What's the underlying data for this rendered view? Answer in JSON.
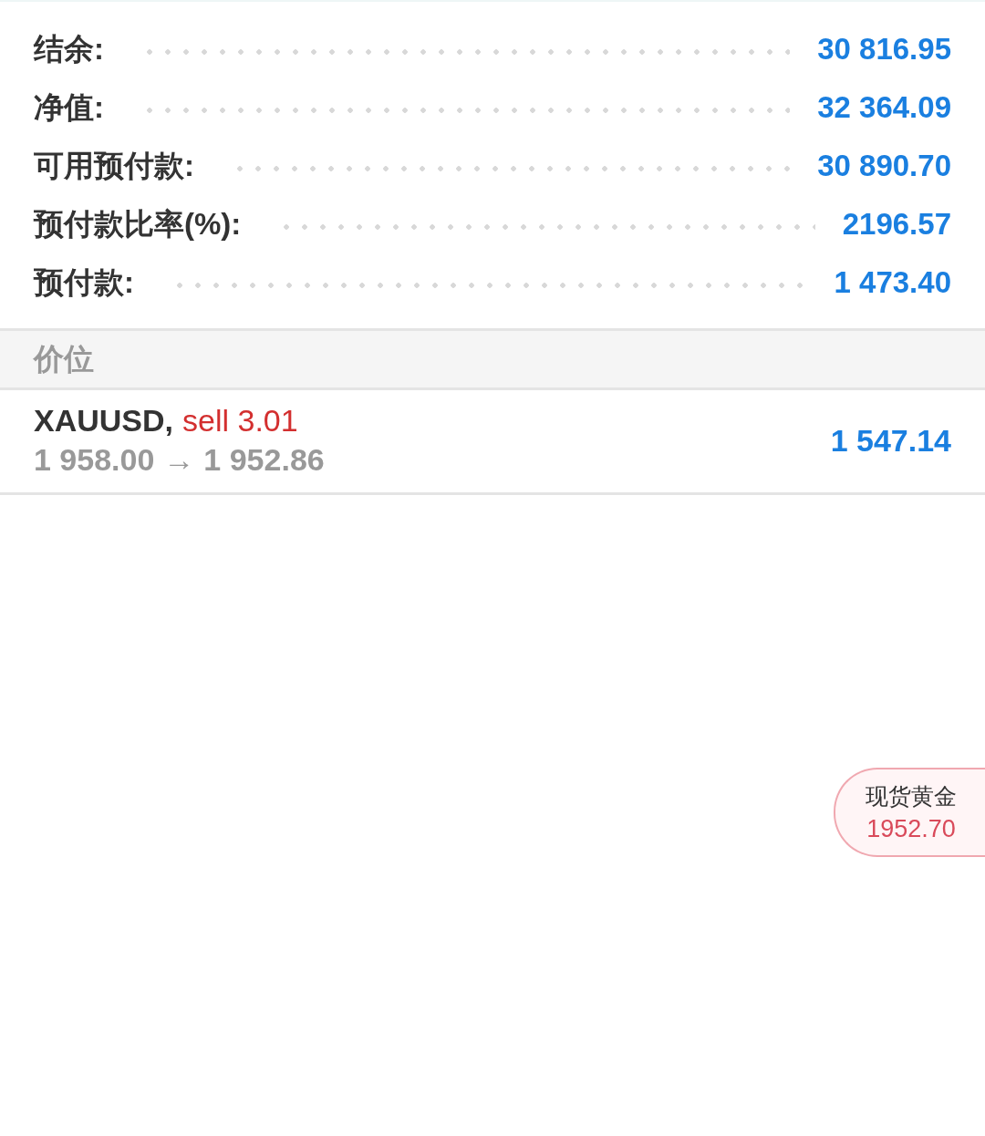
{
  "summary": [
    {
      "label": "结余:",
      "value": "30 816.95"
    },
    {
      "label": "净值:",
      "value": "32 364.09"
    },
    {
      "label": "可用预付款:",
      "value": "30 890.70"
    },
    {
      "label": "预付款比率(%):",
      "value": "2196.57"
    },
    {
      "label": "预付款:",
      "value": "1 473.40"
    }
  ],
  "section": {
    "title": "价位"
  },
  "positions": [
    {
      "symbol": "XAUUSD,",
      "order": "sell 3.01",
      "kind": "sell",
      "open_price": "1 958.00",
      "arrow": "→",
      "current_price": "1 952.86",
      "profit": "1 547.14"
    }
  ],
  "price_badge": {
    "name": "现货黄金",
    "price": "1952.70"
  }
}
